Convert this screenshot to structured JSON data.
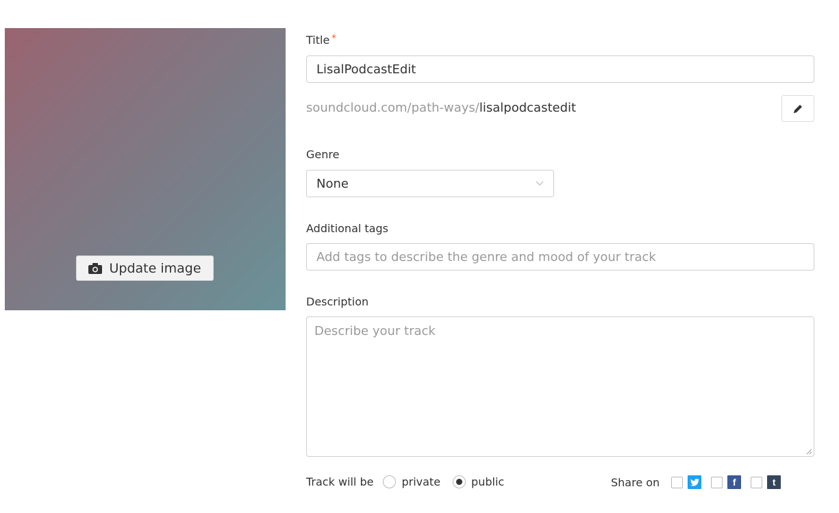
{
  "artwork": {
    "update_label": "Update image"
  },
  "title": {
    "label": "Title",
    "required_mark": "*",
    "value": "LisalPodcastEdit"
  },
  "permalink": {
    "base": "soundcloud.com/path-ways/",
    "slug": "lisalpodcastedit"
  },
  "genre": {
    "label": "Genre",
    "selected": "None"
  },
  "tags": {
    "label": "Additional tags",
    "placeholder": "Add tags to describe the genre and mood of your track"
  },
  "description": {
    "label": "Description",
    "placeholder": "Describe your track"
  },
  "privacy": {
    "label": "Track will be",
    "private_label": "private",
    "public_label": "public",
    "selected": "public"
  },
  "share": {
    "label": "Share on",
    "networks": [
      {
        "icon": "twitter-icon",
        "color": "#1da1f2"
      },
      {
        "icon": "facebook-icon",
        "color": "#3b5998"
      },
      {
        "icon": "tumblr-icon",
        "color": "#35465c"
      }
    ]
  }
}
